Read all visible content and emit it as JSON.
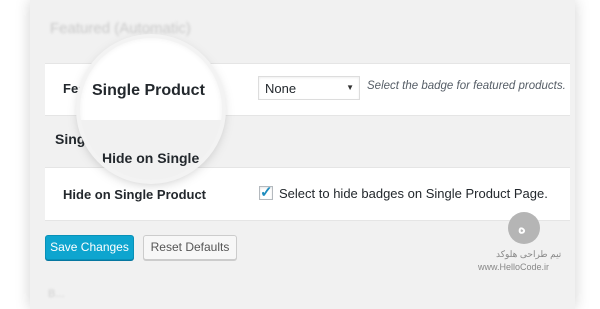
{
  "top_faded_title": "Featured (Automatic)",
  "featured_section": {
    "label_partial": "Featu",
    "select_value": "None",
    "description": "Select the badge for featured products."
  },
  "single_section": {
    "title_partial": "Single",
    "label": "Hide on Single Product",
    "checkbox_checked": true,
    "checkbox_label": "Select to hide badges on Single Product Page."
  },
  "magnifier": {
    "line1": "Single Product",
    "line2": "Hide on Single"
  },
  "buttons": {
    "save_label": "Save Changes",
    "reset_label": "Reset Defaults"
  },
  "bottom_faded": "B...",
  "watermark": {
    "logo_mark": "ه",
    "line1": "تیم طراحی هلوکد",
    "line2": "www.HelloCode.ir"
  },
  "colors": {
    "primary_button": "#0ea5cf",
    "checkmark": "#1e8cbe",
    "panel_bg": "#f1f1f1"
  }
}
